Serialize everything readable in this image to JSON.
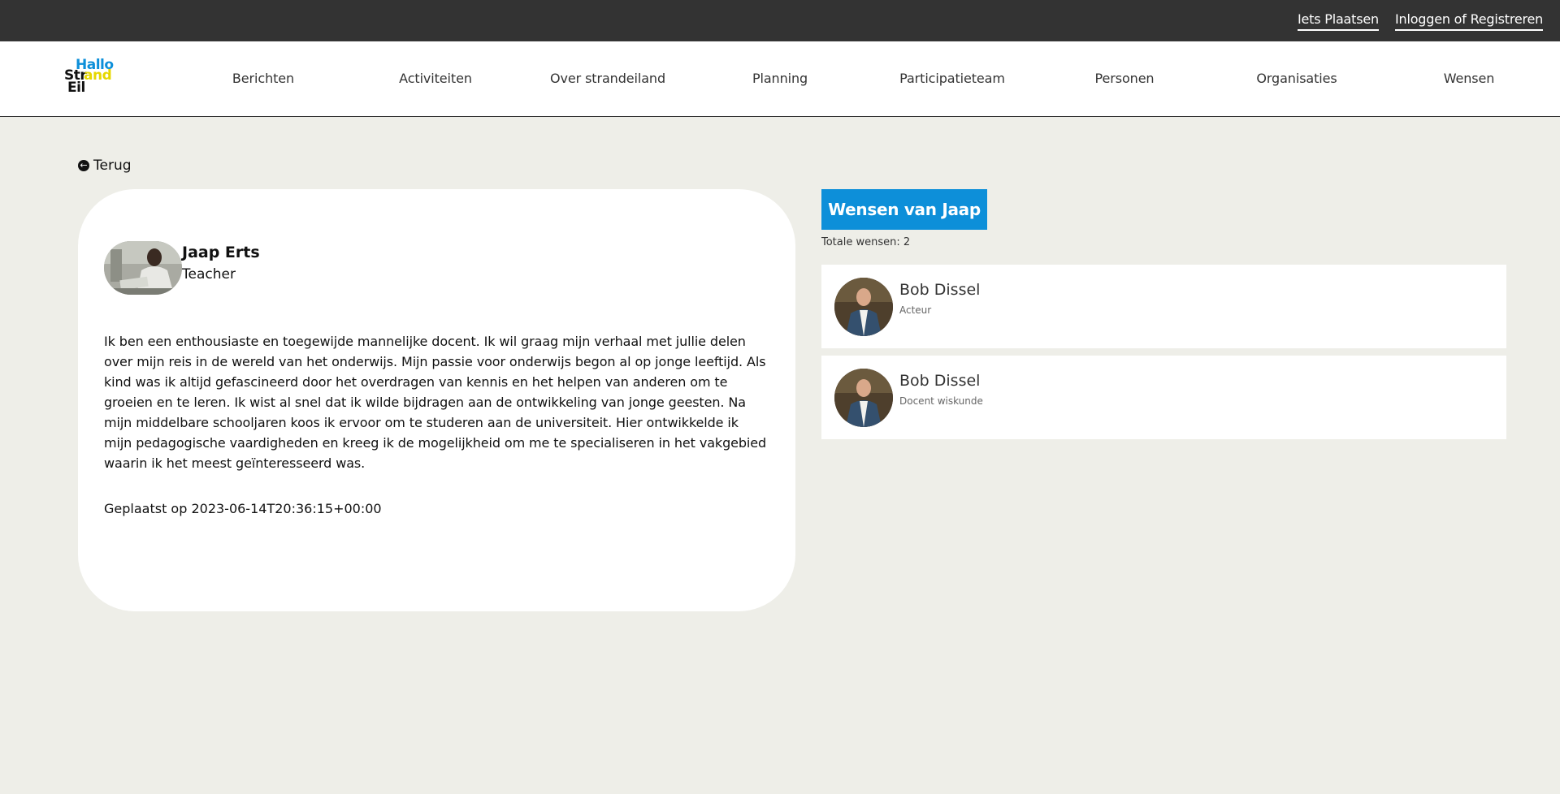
{
  "topbar": {
    "post_link": "Iets Plaatsen",
    "login_link": "Inloggen of Registreren"
  },
  "logo": {
    "line1": "Hallo",
    "line2a": "Str",
    "line2b": "and",
    "line3": "Eil"
  },
  "nav": {
    "items": [
      "Berichten",
      "Activiteiten",
      "Over strandeiland",
      "Planning",
      "Participatieteam",
      "Personen",
      "Organisaties",
      "Wensen"
    ]
  },
  "back_label": "Terug",
  "profile": {
    "name": "Jaap Erts",
    "role": "Teacher",
    "bio": "Ik ben een enthousiaste en toegewijde mannelijke docent. Ik wil graag mijn verhaal met jullie delen over mijn reis in de wereld van het onderwijs. Mijn passie voor onderwijs begon al op jonge leeftijd. Als kind was ik altijd gefascineerd door het overdragen van kennis en het helpen van anderen om te groeien en te leren. Ik wist al snel dat ik wilde bijdragen aan de ontwikkeling van jonge geesten. Na mijn middelbare schooljaren koos ik ervoor om te studeren aan de universiteit. Hier ontwikkelde ik mijn pedagogische vaardigheden en kreeg ik de mogelijkheid om me te specialiseren in het vakgebied waarin ik het meest geïnteresseerd was.",
    "posted": "Geplaatst op 2023-06-14T20:36:15+00:00"
  },
  "wishes": {
    "header": "Wensen van Jaap",
    "total": "Totale wensen: 2",
    "items": [
      {
        "name": "Bob Dissel",
        "role": "Acteur"
      },
      {
        "name": "Bob Dissel",
        "role": "Docent wiskunde"
      }
    ]
  },
  "colors": {
    "accent": "#0d8fd9",
    "logo_yellow": "#e6d700",
    "topbar": "#333333",
    "background": "#eeeee8"
  }
}
